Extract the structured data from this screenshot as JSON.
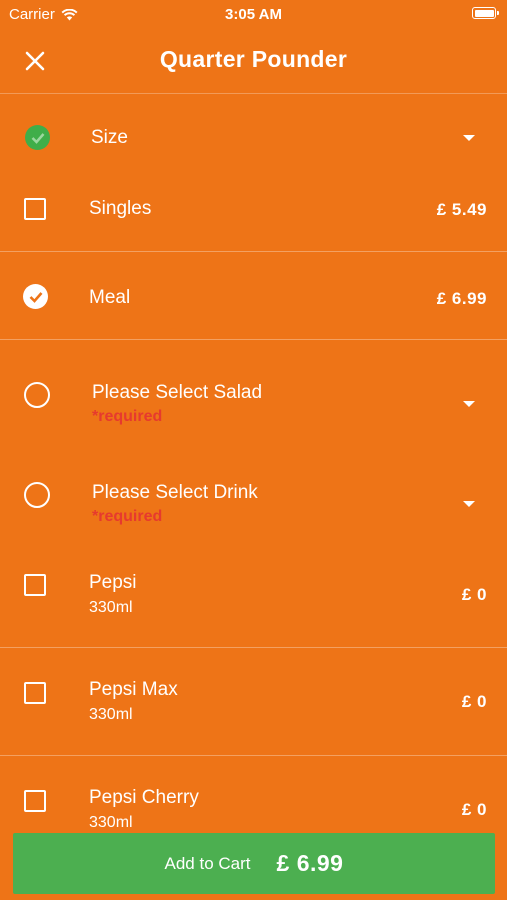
{
  "status_bar": {
    "carrier": "Carrier",
    "time": "3:05 AM"
  },
  "nav": {
    "title": "Quarter Pounder"
  },
  "size_group": {
    "label": "Size"
  },
  "options": [
    {
      "name": "Singles",
      "price": "£ 5.49",
      "selected": false
    },
    {
      "name": "Meal",
      "price": "£ 6.99",
      "selected": true
    }
  ],
  "salad_group": {
    "label": "Please Select Salad",
    "required": "*required"
  },
  "drink_group": {
    "label": "Please Select Drink",
    "required": "*required"
  },
  "drinks": [
    {
      "name": "Pepsi",
      "size": "330ml",
      "price": "£ 0"
    },
    {
      "name": "Pepsi Max",
      "size": "330ml",
      "price": "£ 0"
    },
    {
      "name": "Pepsi Cherry",
      "size": "330ml",
      "price": "£ 0"
    }
  ],
  "cart": {
    "label": "Add to Cart",
    "price": "£ 6.99"
  },
  "colors": {
    "background": "#EE7417",
    "accent_green": "#4CAF50",
    "required_red": "#E63A2E"
  }
}
